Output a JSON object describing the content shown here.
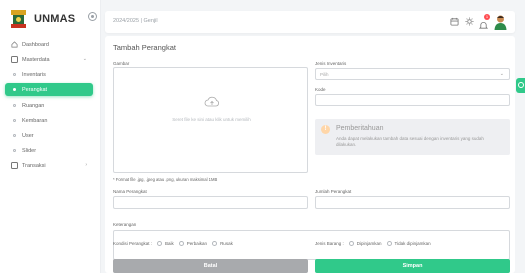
{
  "app": {
    "name": "UNMAS"
  },
  "sidebar": {
    "items": [
      {
        "label": "Dashboard"
      },
      {
        "label": "Masterdata"
      },
      {
        "label": "Inventaris"
      },
      {
        "label": "Perangkat"
      },
      {
        "label": "Ruangan"
      },
      {
        "label": "Kembaran"
      },
      {
        "label": "User"
      },
      {
        "label": "Slider"
      },
      {
        "label": "Transaksi"
      }
    ]
  },
  "header": {
    "period": "2024/2025 | Genjil",
    "notification_count": "1"
  },
  "form": {
    "title": "Tambah Perangkat",
    "image_label": "Gambar",
    "dropzone_text": "Seret file ke sini atau klik untuk memilih",
    "image_note": "* Format file .jpg, .jpeg atau .png, ukuran maksimal 1MB",
    "jenis_inventaris_label": "Jenis Inventaris",
    "jenis_inventaris_value": "Pilih",
    "kode_label": "Kode",
    "alert_title": "Pemberitahuan",
    "alert_body": "Anda dapat melakukan tambah data sesuai dengan inventaris yang sudah dilakukan.",
    "nama_label": "Nama Perangkat",
    "jumlah_label": "Jumlah Perangkat",
    "keterangan_label": "Keterangan",
    "kondisi_label": "Kondisi Perangkat :",
    "kondisi_options": [
      "Baik",
      "Perbaikan",
      "Rusak"
    ],
    "jenis_barang_label": "Jenis Barang :",
    "jenis_barang_options": [
      "Dipinjamkan",
      "Tidak dipinjamkan"
    ],
    "cancel_label": "Batal",
    "save_label": "Simpan"
  },
  "colors": {
    "accent": "#30c98a",
    "cancel": "#a8aaad",
    "badge": "#ff4c51"
  }
}
